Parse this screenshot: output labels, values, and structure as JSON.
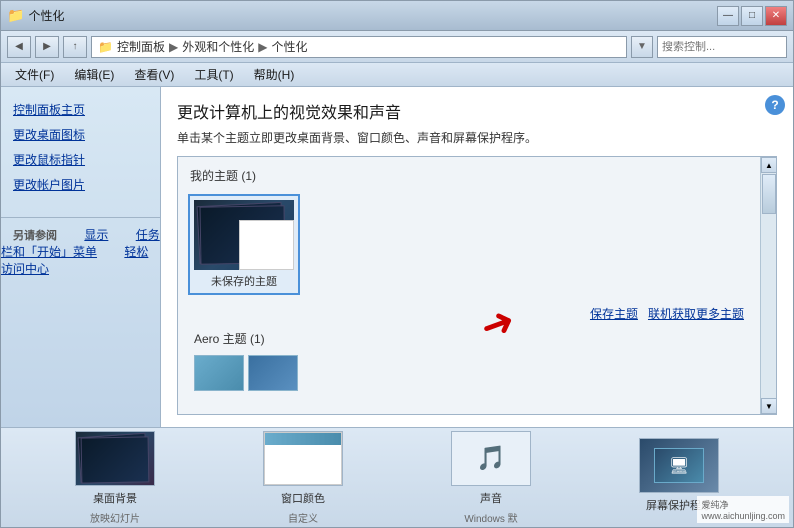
{
  "window": {
    "title": "个性化",
    "controls": {
      "minimize": "—",
      "maximize": "□",
      "close": "✕"
    }
  },
  "address": {
    "path_parts": [
      "控制面板",
      "外观和个性化",
      "个性化"
    ],
    "search_placeholder": "搜索控制..."
  },
  "menu": {
    "items": [
      "文件(F)",
      "编辑(E)",
      "查看(V)",
      "工具(T)",
      "帮助(H)"
    ]
  },
  "sidebar": {
    "main_links": [
      "控制面板主页",
      "更改桌面图标",
      "更改鼠标指针",
      "更改帐户图片"
    ],
    "section_title": "另请参阅",
    "section_links": [
      "显示",
      "任务栏和「开始」菜单",
      "轻松访问中心"
    ]
  },
  "content": {
    "title": "更改计算机上的视觉效果和声音",
    "description": "单击某个主题立即更改桌面背景、窗口颜色、声音和屏幕保护程序。",
    "my_themes_label": "我的主题 (1)",
    "unsaved_theme_label": "未保存的主题",
    "save_theme_link": "保存主题",
    "online_themes_link": "联机获取更多主题",
    "aero_themes_label": "Aero 主题 (1)",
    "save_links": {
      "save": "保存主题",
      "online": "联机获取更多主题"
    }
  },
  "bottom_bar": {
    "items": [
      {
        "id": "desktop-bg",
        "label": "桌面背景",
        "sublabel": "放映幻灯片"
      },
      {
        "id": "window-color",
        "label": "窗口颜色",
        "sublabel": "自定义"
      },
      {
        "id": "sound",
        "label": "声音",
        "sublabel": "Windows 默"
      },
      {
        "id": "screensaver",
        "label": "屏幕保护程序",
        "sublabel": ""
      }
    ]
  },
  "watermark": {
    "text": "www.aichunljing.com",
    "brand": "爱纯净"
  },
  "icons": {
    "help": "?",
    "back": "◀",
    "forward": "▶",
    "dropdown": "▼",
    "search": "🔍",
    "scroll_up": "▲",
    "scroll_down": "▼"
  }
}
